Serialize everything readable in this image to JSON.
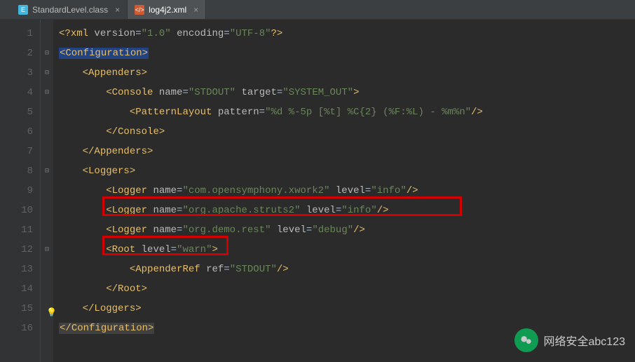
{
  "tabs": [
    {
      "label": "StandardLevel.class",
      "icon_bg": "#40b6e0",
      "icon_glyph": "E",
      "active": false
    },
    {
      "label": "log4j2.xml",
      "icon_bg": "#d05b32",
      "icon_glyph": "</>",
      "active": true
    }
  ],
  "lines": {
    "l1": {
      "num": "1",
      "content": "<?xml version=\"1.0\" encoding=\"UTF-8\"?>"
    },
    "l2": {
      "num": "2",
      "content": "<Configuration>"
    },
    "l3": {
      "num": "3",
      "content": "    <Appenders>"
    },
    "l4": {
      "num": "4",
      "content": "        <Console name=\"STDOUT\" target=\"SYSTEM_OUT\">"
    },
    "l5": {
      "num": "5",
      "content": "            <PatternLayout pattern=\"%d %-5p [%t] %C{2} (%F:%L) - %m%n\"/>"
    },
    "l6": {
      "num": "6",
      "content": "        </Console>"
    },
    "l7": {
      "num": "7",
      "content": "    </Appenders>"
    },
    "l8": {
      "num": "8",
      "content": "    <Loggers>"
    },
    "l9": {
      "num": "9",
      "content": "        <Logger name=\"com.opensymphony.xwork2\" level=\"info\"/>"
    },
    "l10": {
      "num": "10",
      "content": "        <Logger name=\"org.apache.struts2\" level=\"info\"/>"
    },
    "l11": {
      "num": "11",
      "content": "        <Logger name=\"org.demo.rest\" level=\"debug\"/>"
    },
    "l12": {
      "num": "12",
      "content": "        <Root level=\"warn\">"
    },
    "l13": {
      "num": "13",
      "content": "            <AppenderRef ref=\"STDOUT\"/>"
    },
    "l14": {
      "num": "14",
      "content": "        </Root>"
    },
    "l15": {
      "num": "15",
      "content": "    </Loggers>"
    },
    "l16": {
      "num": "16",
      "content": "</Configuration>"
    }
  },
  "watermark": "网络安全abc123"
}
